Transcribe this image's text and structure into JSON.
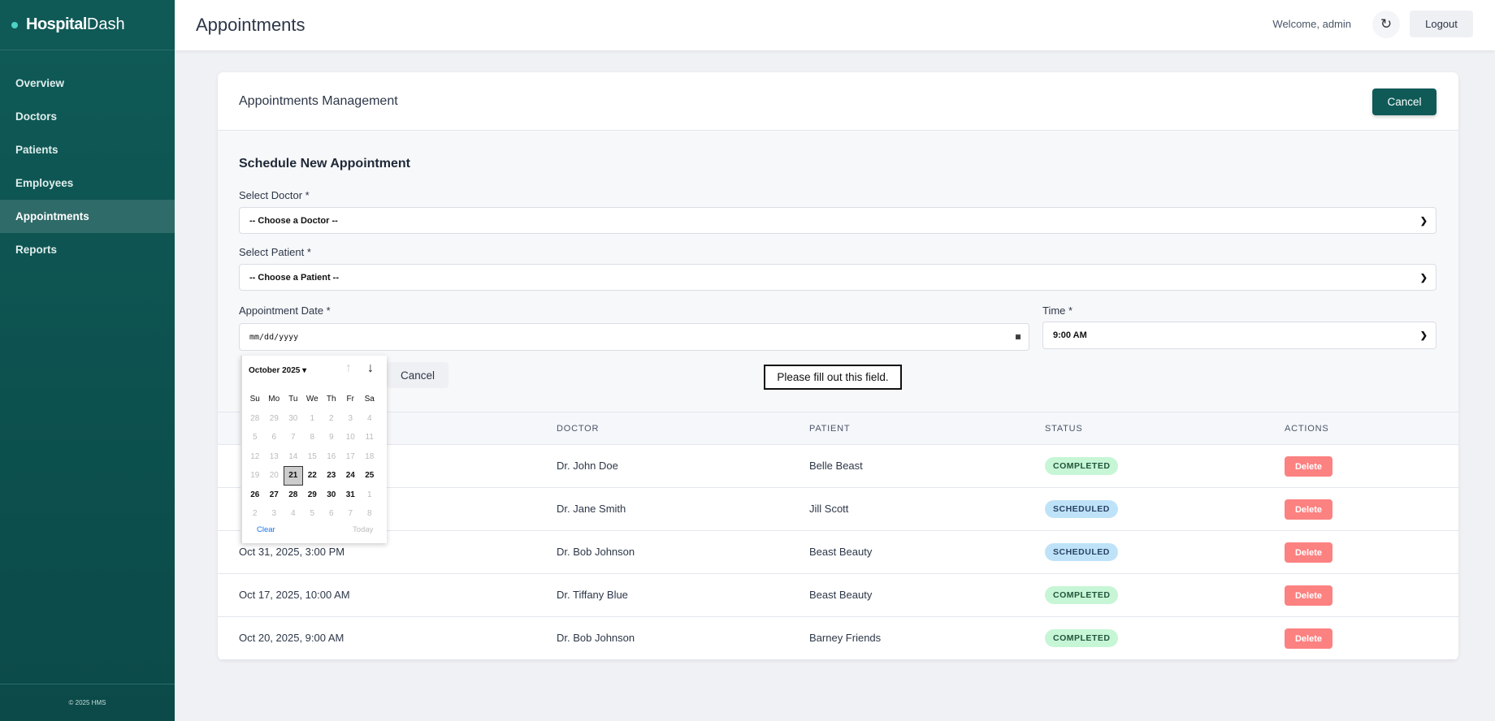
{
  "app": {
    "brand_bold": "Hospital",
    "brand_light": "Dash",
    "footer": "© 2025 HMS"
  },
  "sidebar": {
    "items": [
      {
        "label": "Overview"
      },
      {
        "label": "Doctors"
      },
      {
        "label": "Patients"
      },
      {
        "label": "Employees"
      },
      {
        "label": "Appointments",
        "active": true
      },
      {
        "label": "Reports"
      }
    ]
  },
  "header": {
    "title": "Appointments",
    "welcome": "Welcome, admin",
    "refresh_icon": "↻",
    "logout": "Logout"
  },
  "card": {
    "title": "Appointments Management",
    "cancel": "Cancel"
  },
  "form": {
    "title": "Schedule New Appointment",
    "doctor_label": "Select Doctor *",
    "doctor_value": "-- Choose a Doctor --",
    "patient_label": "Select Patient *",
    "patient_value": "-- Choose a Patient --",
    "date_label": "Appointment Date *",
    "date_placeholder": "mm/dd/yyyy",
    "time_label": "Time *",
    "time_value": "9:00 AM",
    "cancel": "Cancel",
    "validation_tooltip": "Please fill out this field."
  },
  "datepicker": {
    "month_label": "October 2025 ▾",
    "weekdays": [
      "Su",
      "Mo",
      "Tu",
      "We",
      "Th",
      "Fr",
      "Sa"
    ],
    "days": [
      [
        "28",
        0
      ],
      [
        "29",
        0
      ],
      [
        "30",
        0
      ],
      [
        "1",
        0
      ],
      [
        "2",
        0
      ],
      [
        "3",
        0
      ],
      [
        "4",
        0
      ],
      [
        "5",
        0
      ],
      [
        "6",
        0
      ],
      [
        "7",
        0
      ],
      [
        "8",
        0
      ],
      [
        "9",
        0
      ],
      [
        "10",
        0
      ],
      [
        "11",
        0
      ],
      [
        "12",
        0
      ],
      [
        "13",
        0
      ],
      [
        "14",
        0
      ],
      [
        "15",
        0
      ],
      [
        "16",
        0
      ],
      [
        "17",
        0
      ],
      [
        "18",
        0
      ],
      [
        "19",
        0
      ],
      [
        "20",
        0
      ],
      [
        "21",
        2
      ],
      [
        "22",
        1
      ],
      [
        "23",
        1
      ],
      [
        "24",
        1
      ],
      [
        "25",
        1
      ],
      [
        "26",
        1
      ],
      [
        "27",
        1
      ],
      [
        "28",
        1
      ],
      [
        "29",
        1
      ],
      [
        "30",
        1
      ],
      [
        "31",
        1
      ],
      [
        "1",
        0
      ],
      [
        "2",
        0
      ],
      [
        "3",
        0
      ],
      [
        "4",
        0
      ],
      [
        "5",
        0
      ],
      [
        "6",
        0
      ],
      [
        "7",
        0
      ],
      [
        "8",
        0
      ]
    ],
    "clear": "Clear",
    "today": "Today"
  },
  "table": {
    "headers": {
      "doctor": "DOCTOR",
      "patient": "PATIENT",
      "status": "STATUS",
      "actions": "ACTIONS"
    },
    "rows": [
      {
        "date": "",
        "doctor": "Dr. John Doe",
        "patient": "Belle Beast",
        "status": "COMPLETED",
        "action": "Delete"
      },
      {
        "date": "",
        "doctor": "Dr. Jane Smith",
        "patient": "Jill Scott",
        "status": "SCHEDULED",
        "action": "Delete"
      },
      {
        "date": "Oct 31, 2025, 3:00 PM",
        "doctor": "Dr. Bob Johnson",
        "patient": "Beast Beauty",
        "status": "SCHEDULED",
        "action": "Delete"
      },
      {
        "date": "Oct 17, 2025, 10:00 AM",
        "doctor": "Dr. Tiffany Blue",
        "patient": "Beast Beauty",
        "status": "COMPLETED",
        "action": "Delete"
      },
      {
        "date": "Oct 20, 2025, 9:00 AM",
        "doctor": "Dr. Bob Johnson",
        "patient": "Barney Friends",
        "status": "COMPLETED",
        "action": "Delete"
      }
    ]
  },
  "colors": {
    "sidebar": "#0f5a57",
    "primary": "#0f5a57",
    "delete": "#fc8181",
    "completed": "#c6f6d5",
    "scheduled": "#bee3f8"
  }
}
